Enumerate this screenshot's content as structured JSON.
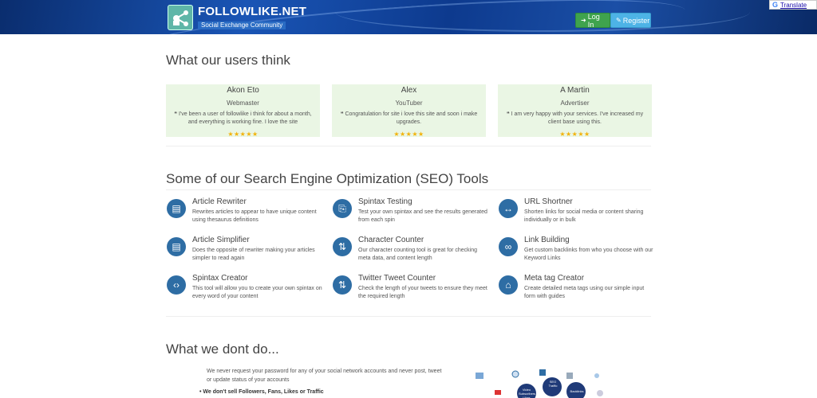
{
  "header": {
    "logo_title": "FOLLOWLIKE.NET",
    "logo_subtitle": "Social Exchange Community",
    "login_label": "Log In",
    "register_label": "Register",
    "translate_label": "Translate",
    "translate_g": "G"
  },
  "users_section": {
    "heading": "What our users think",
    "testimonials": [
      {
        "name": "Akon Eto",
        "role": "Webmaster",
        "quote": "I've been a user of followlike i think for about a month, and everything is working fine. I love the site",
        "stars": "★★★★★"
      },
      {
        "name": "Alex",
        "role": "YouTuber",
        "quote": "Congratulation for site i love this site and soon i make upgrades.",
        "stars": "★★★★★"
      },
      {
        "name": "A Martin",
        "role": "Advertiser",
        "quote": "I am very happy with your services. I've increased my client base using this.",
        "stars": "★★★★★"
      }
    ],
    "ratings": [
      4.5,
      5,
      4.5
    ]
  },
  "seo_section": {
    "heading": "Some of our Search Engine Optimization (SEO) Tools",
    "tools": [
      {
        "title": "Article Rewriter",
        "desc": "Rewrites articles to appear to have unique content using thesaurus definitions",
        "icon": "book-icon"
      },
      {
        "title": "Spintax Testing",
        "desc": "Test your own spintax and see the results generated from each spin",
        "icon": "code-file-icon"
      },
      {
        "title": "URL Shortner",
        "desc": "Shorten links for social media or content sharing individually or in bulk",
        "icon": "arrows-horizontal-icon"
      },
      {
        "title": "Article Simplifier",
        "desc": "Does the opposite of rewriter making your articles simpler to read again",
        "icon": "book-icon"
      },
      {
        "title": "Character Counter",
        "desc": "Our character counting tool is great for checking meta data, and content length",
        "icon": "sort-numeric-icon"
      },
      {
        "title": "Link Building",
        "desc": "Get custom backlinks from who you choose with our Keyword Links",
        "icon": "link-icon"
      },
      {
        "title": "Spintax Creator",
        "desc": "This tool will allow you to create your own spintax on every word of your content",
        "icon": "code-icon"
      },
      {
        "title": "Twitter Tweet Counter",
        "desc": "Check the length of your tweets to ensure they meet the required length",
        "icon": "sort-numeric-icon"
      },
      {
        "title": "Meta tag Creator",
        "desc": "Create detailed meta tags using our simple input form with guides",
        "icon": "tags-icon"
      }
    ]
  },
  "dont_section": {
    "heading": "What we dont do...",
    "text": "We never request your password for any of your social network accounts and never post, tweet or update status of your accounts",
    "bullet": "• We don't sell Followers, Fans, Likes or Traffic",
    "graphic_labels": [
      "SEO Traffic",
      "Video Subscribers Likes",
      "Backlinks"
    ]
  },
  "colors": {
    "header_dark": "#0a2d6e",
    "login_green": "#3fa34d",
    "register_blue": "#4db3e6",
    "testimonial_bg": "#eaf6e4",
    "icon_blue": "#2e6da4",
    "star_gold": "#f2b20a"
  }
}
